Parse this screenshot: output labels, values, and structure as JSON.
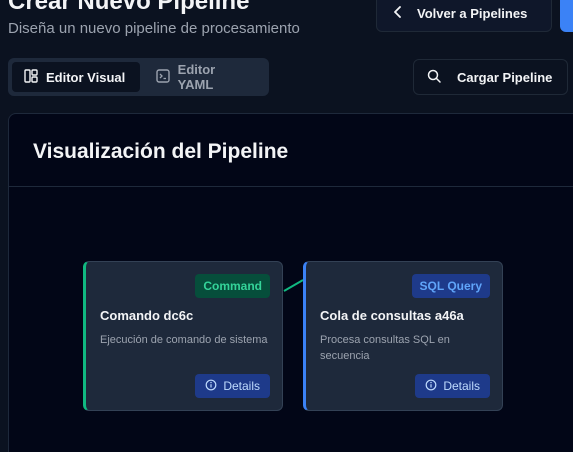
{
  "header": {
    "title": "Crear Nuevo Pipeline",
    "subtitle": "Diseña un nuevo pipeline de procesamiento",
    "back_label": "Volver a Pipelines"
  },
  "tabs": [
    {
      "label": "Editor Visual",
      "icon": "layout-icon",
      "active": true
    },
    {
      "label": "Editor YAML",
      "icon": "terminal-icon",
      "active": false
    }
  ],
  "load_label": "Cargar Pipeline",
  "panel": {
    "title": "Visualización del Pipeline"
  },
  "nodes": [
    {
      "badge": "Command",
      "title": "Comando dc6c",
      "description": "Ejecución de comando de sistema",
      "details_label": "Details",
      "accent": "#10b981"
    },
    {
      "badge": "SQL Query",
      "title": "Cola de consultas a46a",
      "description": "Procesa consultas SQL en secuencia",
      "details_label": "Details",
      "accent": "#3b82f6"
    }
  ],
  "colors": {
    "accent": "#3b82f6",
    "success": "#10b981",
    "background": "#0b1220"
  }
}
